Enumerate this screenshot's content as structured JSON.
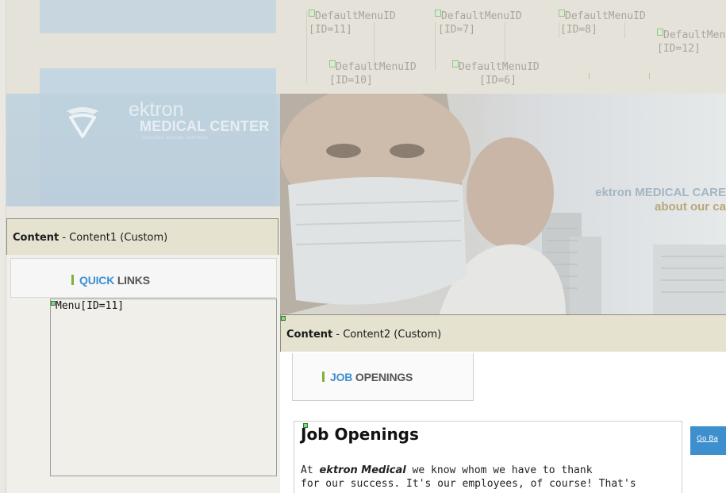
{
  "menu_placeholders": [
    {
      "label": "DefaultMenuID",
      "id": "[ID=11]"
    },
    {
      "label": "DefaultMenuID",
      "id": "[ID=7]"
    },
    {
      "label": "DefaultMenuID",
      "id": "[ID=8]"
    },
    {
      "label": "DefaultMenuID",
      "id": "[ID=12]"
    },
    {
      "label": "DefaultMenuID",
      "id": "[ID=10]"
    },
    {
      "label": "DefaultMenuID",
      "id": "[ID=6]"
    }
  ],
  "logo": {
    "name": "ektron",
    "title": "MEDICAL CENTER",
    "tagline": "QUALIFIED MEDICAL SERVICES"
  },
  "hero": {
    "line1": "ektron MEDICAL CARE",
    "line2": "about our ca"
  },
  "content1": {
    "header_bold": "Content",
    "header_rest": " - Content1 (Custom)",
    "section_accent": "QUICK",
    "section_rest": "LINKS",
    "menu_placeholder": "Menu[ID=11]"
  },
  "content2": {
    "header_bold": "Content",
    "header_rest": " - Content2 (Custom)",
    "section_accent": "JOB",
    "section_rest": "OPENINGS",
    "article_title": "Job Openings",
    "article_prefix": "At ",
    "article_brand": "ektron Medical",
    "article_line1_rest": "  we know whom we have to thank",
    "article_line2": "for our success. It's our employees, of course! That's",
    "go_back": "Go Ba"
  },
  "colors": {
    "accent_green": "#7fb23a",
    "accent_blue": "#3b8fd1",
    "header_bg": "#e5e2d0"
  }
}
